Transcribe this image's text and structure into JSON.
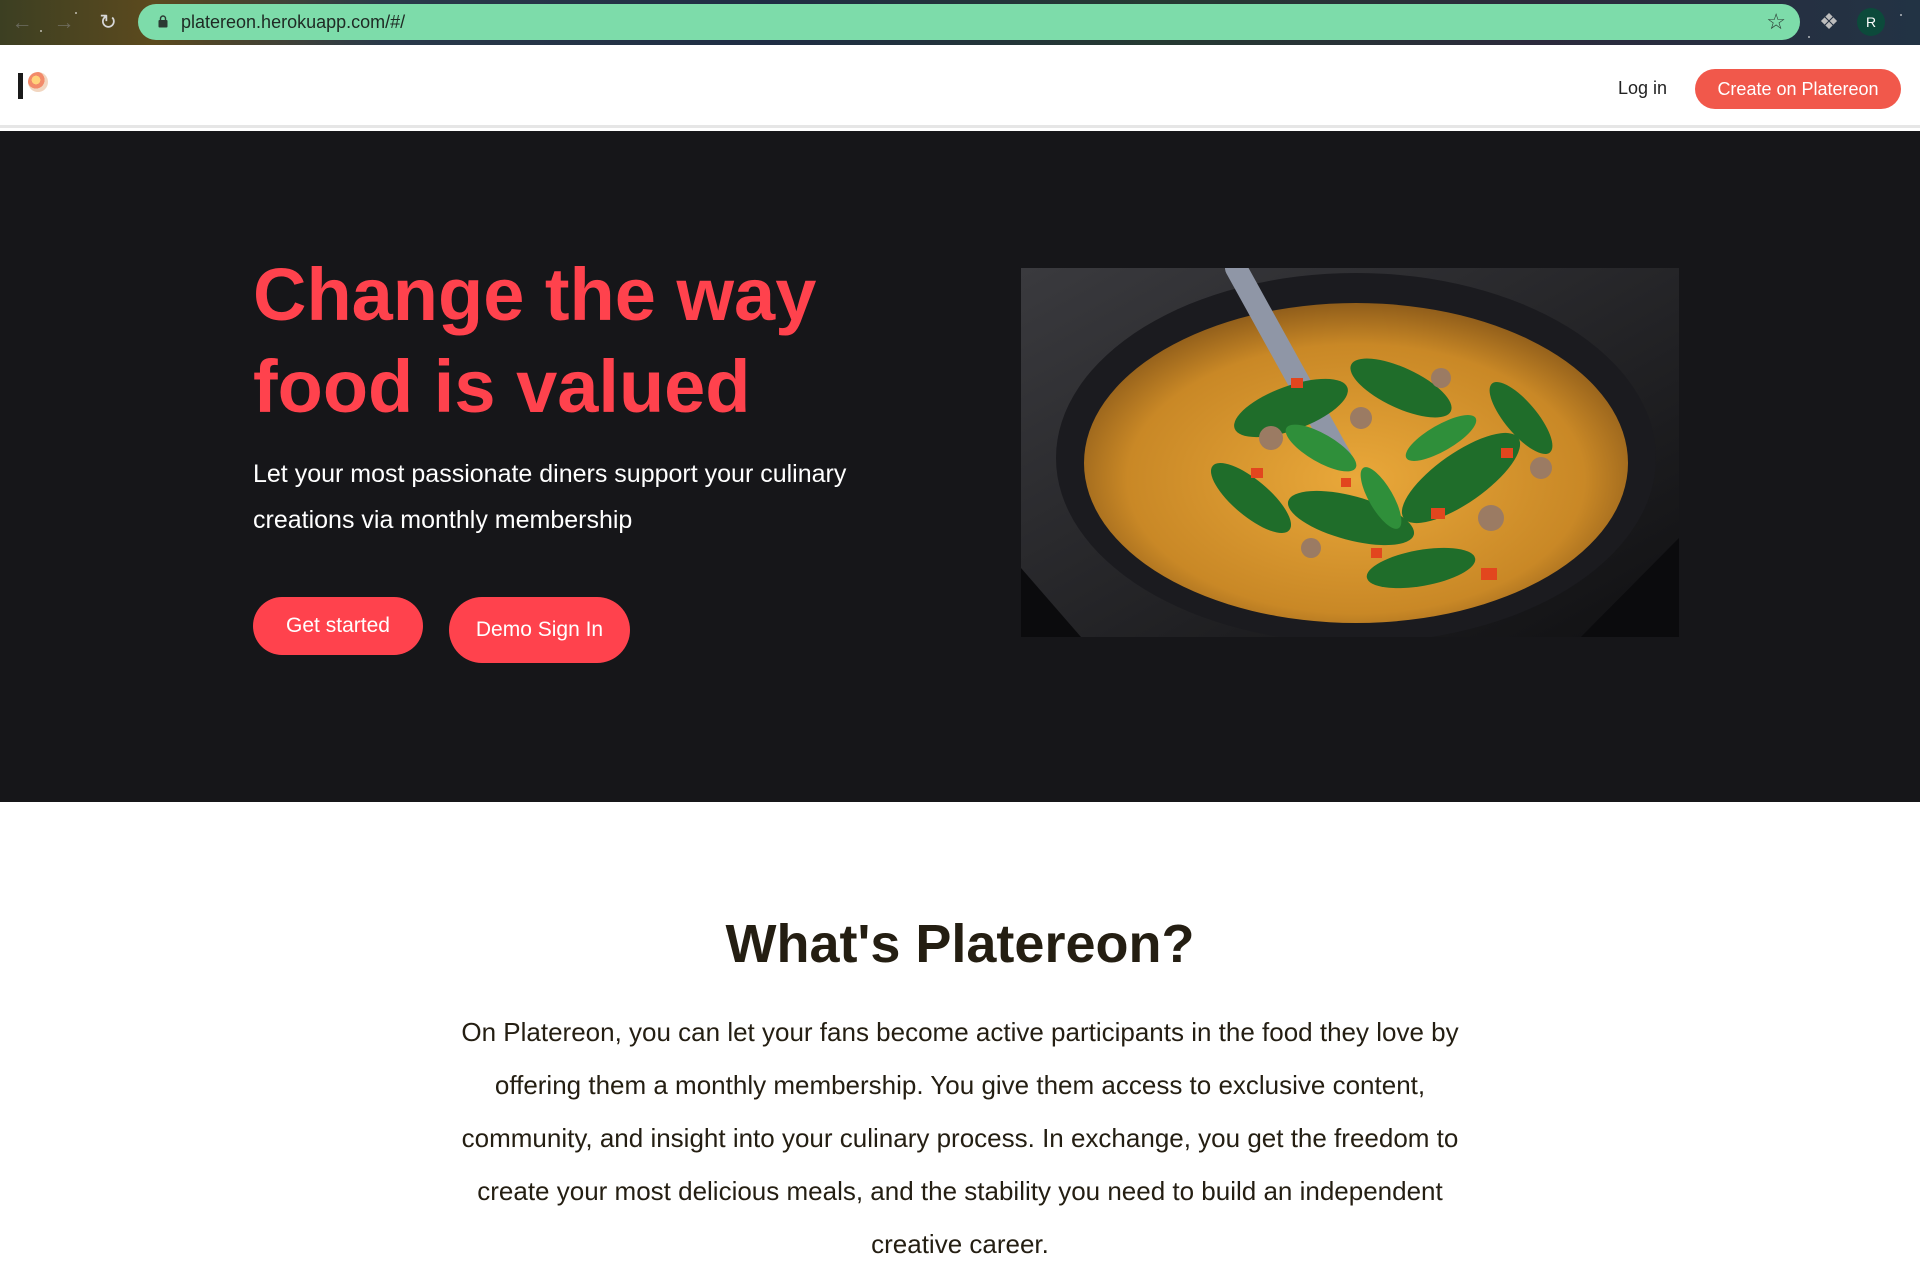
{
  "browser": {
    "url": "platereon.herokuapp.com/#/",
    "profile_initial": "R",
    "icons": {
      "back": "arrow-left-icon",
      "forward": "arrow-right-icon",
      "reload": "reload-icon",
      "lock": "lock-icon",
      "bookmark": "star-icon",
      "extensions": "puzzle-icon"
    },
    "omnibox_color": "#7ddcaa"
  },
  "header": {
    "login_label": "Log in",
    "create_label": "Create on Platereon",
    "accent_color": "#f1584b"
  },
  "hero": {
    "title_line1": "Change the way",
    "title_line2": "food is valued",
    "subtitle_line1": "Let your most passionate diners support your culinary",
    "subtitle_line2": "creations via monthly membership",
    "get_started_label": "Get started",
    "demo_label": "Demo Sign In",
    "accent_color": "#ff424d",
    "background_color": "#161619"
  },
  "about": {
    "title": "What's Platereon?",
    "body_lines": [
      "On Platereon, you can let your fans become active participants in the food they love by",
      "offering them a monthly membership. You give them access to exclusive content,",
      "community, and insight into your culinary process. In exchange, you get the freedom to",
      "create your most delicious meals, and the stability you need to build an independent",
      "creative career."
    ]
  }
}
